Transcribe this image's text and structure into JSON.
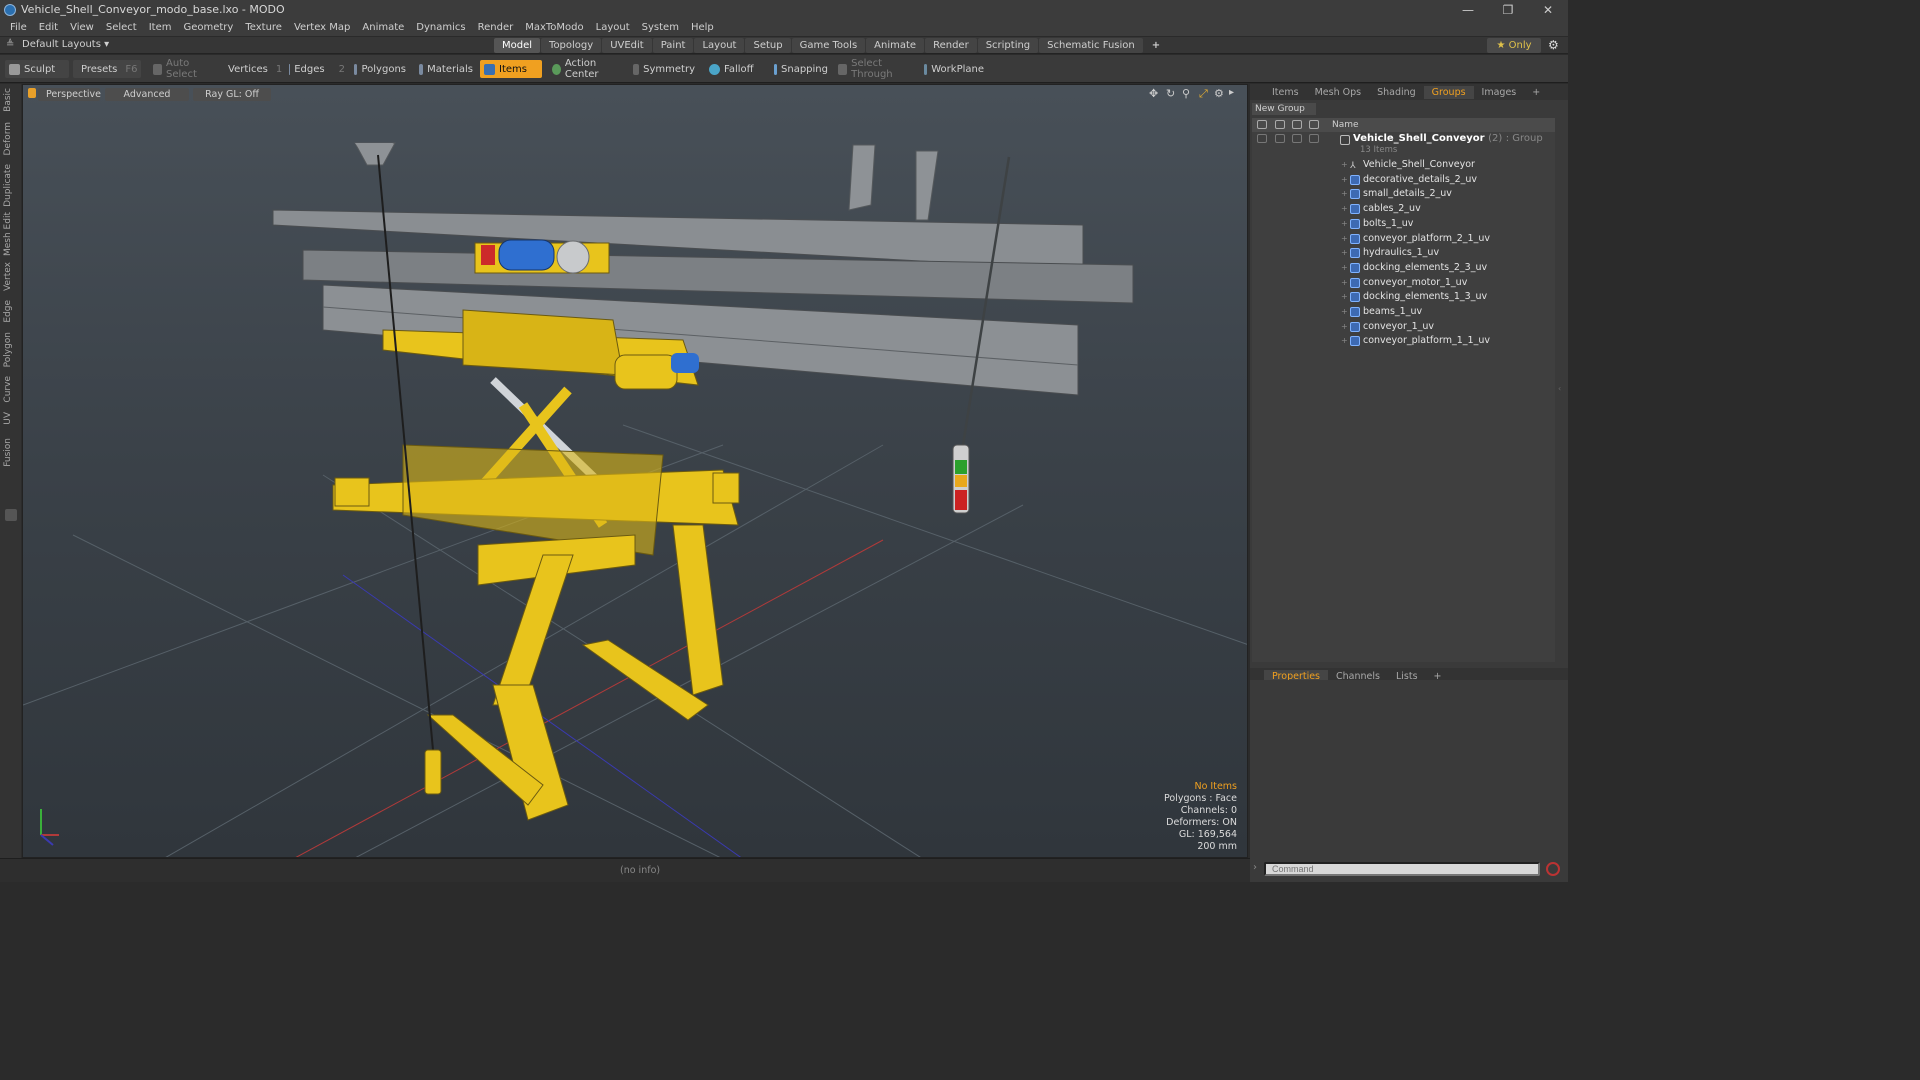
{
  "window": {
    "title": "Vehicle_Shell_Conveyor_modo_base.lxo - MODO",
    "controls": [
      "—",
      "❐",
      "✕"
    ]
  },
  "menu": [
    "File",
    "Edit",
    "View",
    "Select",
    "Item",
    "Geometry",
    "Texture",
    "Vertex Map",
    "Animate",
    "Dynamics",
    "Render",
    "MaxToModo",
    "Layout",
    "System",
    "Help"
  ],
  "layoutbar": {
    "layout_label": "Default Layouts ▾",
    "tabs": [
      "Model",
      "Topology",
      "UVEdit",
      "Paint",
      "Layout",
      "Setup",
      "Game Tools",
      "Animate",
      "Render",
      "Scripting",
      "Schematic Fusion",
      "+"
    ],
    "active_tab": "Model",
    "only_label": "★  Only"
  },
  "toolbar": {
    "sculpt": "Sculpt",
    "presets": "Presets",
    "presets_key": "F6",
    "auto_select": "Auto Select",
    "vertices": "Vertices",
    "vertices_count": "1",
    "edges": "Edges",
    "edges_count": "2",
    "polygons": "Polygons",
    "materials": "Materials",
    "items": "Items",
    "action_center": "Action Center",
    "symmetry": "Symmetry",
    "falloff": "Falloff",
    "snapping": "Snapping",
    "select_through": "Select Through",
    "workplane": "WorkPlane"
  },
  "left_tabs": [
    "Basic",
    "Deform",
    "Duplicate",
    "Mesh Edit",
    "Vertex",
    "Edge",
    "Polygon",
    "Curve",
    "UV",
    "Fusion"
  ],
  "viewport": {
    "view": "Perspective",
    "mode": "Advanced",
    "raygl": "Ray GL: Off",
    "stats": {
      "selection": "No Items",
      "polygons": "Polygons : Face",
      "channels": "Channels: 0",
      "deformers": "Deformers: ON",
      "gl": "GL: 169,564",
      "grid": "200 mm"
    }
  },
  "status": {
    "info": "(no info)"
  },
  "right_tabs": [
    "Items",
    "Mesh Ops",
    "Shading",
    "Groups",
    "Images",
    "+"
  ],
  "right_active": "Groups",
  "groups": {
    "new_group": "New Group",
    "name_header": "Name",
    "group_name": "Vehicle_Shell_Conveyor",
    "group_count": "(2)",
    "group_type": ": Group",
    "group_sub": "13 Items",
    "items": [
      "Vehicle_Shell_Conveyor",
      "decorative_details_2_uv",
      "small_details_2_uv",
      "cables_2_uv",
      "bolts_1_uv",
      "conveyor_platform_2_1_uv",
      "hydraulics_1_uv",
      "docking_elements_2_3_uv",
      "conveyor_motor_1_uv",
      "docking_elements_1_3_uv",
      "beams_1_uv",
      "conveyor_1_uv",
      "conveyor_platform_1_1_uv"
    ]
  },
  "bottom_tabs": [
    "Properties",
    "Channels",
    "Lists",
    "+"
  ],
  "bottom_active": "Properties",
  "command_placeholder": "Command",
  "colors": {
    "accent": "#f0a020",
    "model_yellow": "#e8c41c",
    "motor_blue": "#2f6fd0"
  }
}
